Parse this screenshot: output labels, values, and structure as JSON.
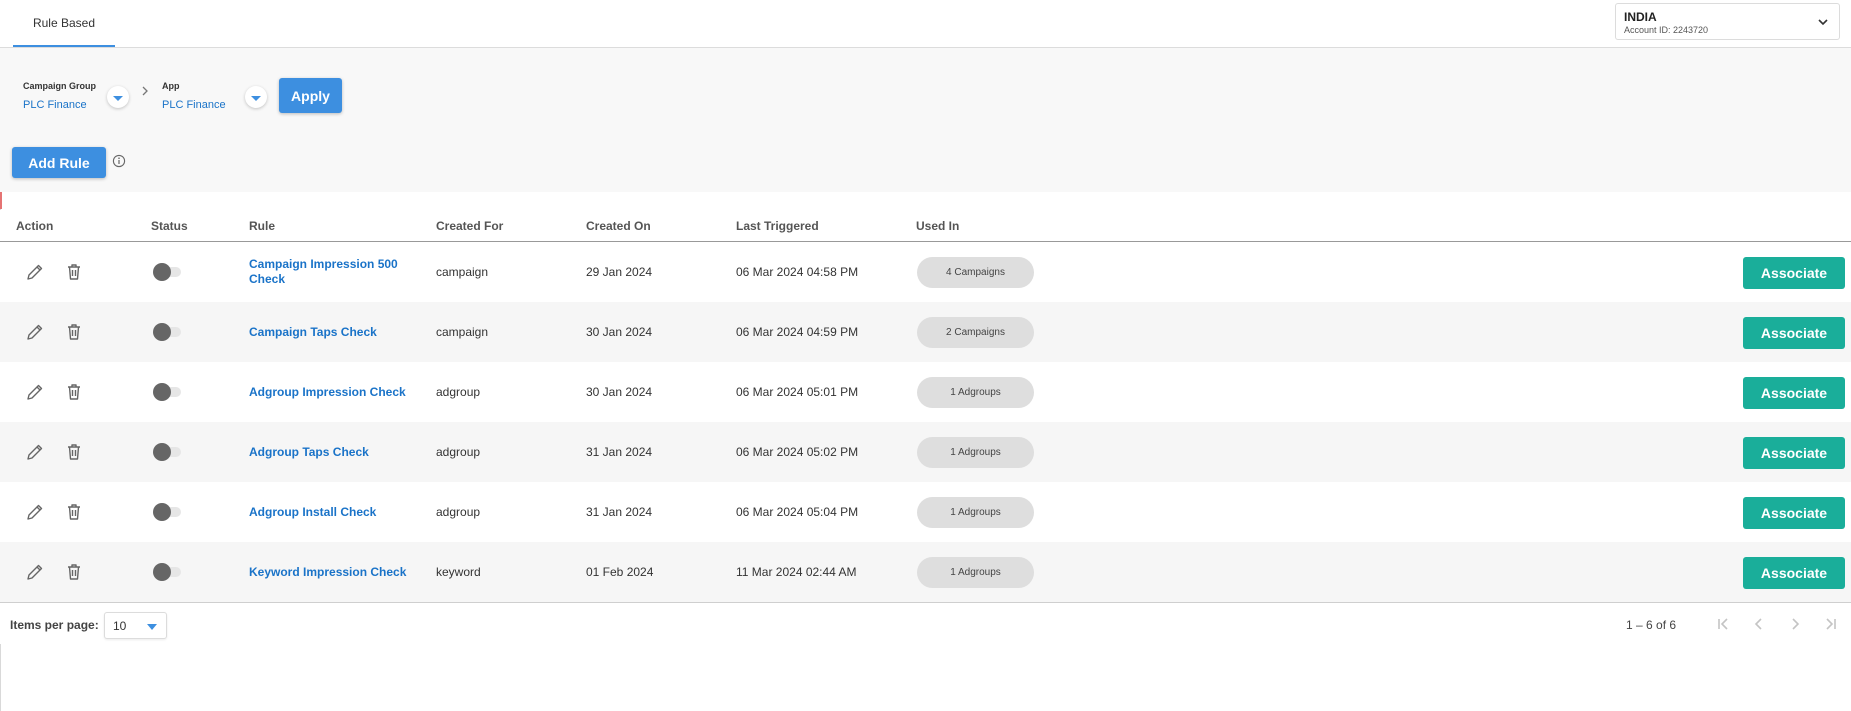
{
  "header": {
    "tab_label": "Rule Based",
    "account": {
      "name": "INDIA",
      "id_text": "Account ID: 2243720"
    }
  },
  "filters": {
    "campaign_group": {
      "label": "Campaign Group",
      "value": "PLC Finance"
    },
    "app": {
      "label": "App",
      "value": "PLC Finance"
    },
    "apply_label": "Apply"
  },
  "add_rule_label": "Add Rule",
  "table": {
    "columns": [
      "Action",
      "Status",
      "Rule",
      "Created For",
      "Created On",
      "Last Triggered",
      "Used In"
    ],
    "rows": [
      {
        "rule": "Campaign Impression 500 Check",
        "created_for": "campaign",
        "created_on": "29 Jan 2024",
        "last_triggered": "06 Mar 2024 04:58 PM",
        "used_in": "4 Campaigns",
        "status": "off",
        "action_label": "Associate"
      },
      {
        "rule": "Campaign Taps Check",
        "created_for": "campaign",
        "created_on": "30 Jan 2024",
        "last_triggered": "06 Mar 2024 04:59 PM",
        "used_in": "2 Campaigns",
        "status": "off",
        "action_label": "Associate"
      },
      {
        "rule": "Adgroup Impression Check",
        "created_for": "adgroup",
        "created_on": "30 Jan 2024",
        "last_triggered": "06 Mar 2024 05:01 PM",
        "used_in": "1 Adgroups",
        "status": "off",
        "action_label": "Associate"
      },
      {
        "rule": "Adgroup Taps Check",
        "created_for": "adgroup",
        "created_on": "31 Jan 2024",
        "last_triggered": "06 Mar 2024 05:02 PM",
        "used_in": "1 Adgroups",
        "status": "off",
        "action_label": "Associate"
      },
      {
        "rule": "Adgroup Install Check",
        "created_for": "adgroup",
        "created_on": "31 Jan 2024",
        "last_triggered": "06 Mar 2024 05:04 PM",
        "used_in": "1 Adgroups",
        "status": "off",
        "action_label": "Associate"
      },
      {
        "rule": "Keyword Impression Check",
        "created_for": "keyword",
        "created_on": "01 Feb 2024",
        "last_triggered": "11 Mar 2024 02:44 AM",
        "used_in": "1 Adgroups",
        "status": "off",
        "action_label": "Associate"
      }
    ]
  },
  "paginator": {
    "items_per_page_label": "Items per page:",
    "items_per_page": "10",
    "range": "1 – 6 of 6"
  },
  "colors": {
    "primary": "#3d8fe0",
    "link": "#1a73c8",
    "associate": "#1aae9a",
    "pill": "#dedede"
  }
}
